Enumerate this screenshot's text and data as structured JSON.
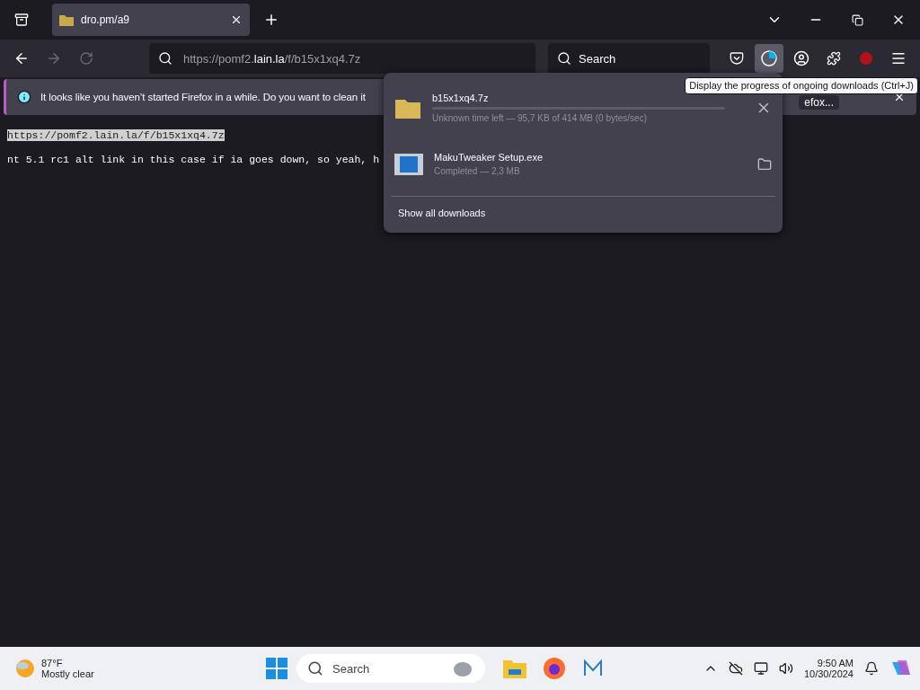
{
  "tabs": [
    {
      "title": "dro.pm/a9",
      "selected": true
    }
  ],
  "address_bar": {
    "value_prefix": "https://pomf2.",
    "value_domain": "lain.la",
    "value_suffix": "/f/b15x1xq4.7z"
  },
  "search": {
    "placeholder": "Search"
  },
  "downloads_button": {
    "active": true
  },
  "notification": {
    "message": "It looks like you haven’t started Firefox in a while. Do you want to clean it",
    "button": "efox..."
  },
  "page": {
    "lines": [
      {
        "text": "https://pomf2.lain.la/f/b15x1xq4.7z",
        "selected": true
      },
      {
        "text": "nt 5.1 rc1 alt link in this case if ia goes down, so yeah, h",
        "selected": false
      }
    ]
  },
  "downloads_panel": {
    "items": [
      {
        "kind": "in_progress",
        "name": "b15x1xq4.7z",
        "status": "Unknown time left — 95,7 KB of 414 MB (0 bytes/sec)",
        "level": 0.0
      },
      {
        "kind": "completed",
        "name": "MakuTweaker Setup.exe",
        "status": "Completed — 2,3 MB"
      }
    ],
    "footer": "Show all downloads"
  },
  "tooltip": "Display the progress of ongoing downloads (Ctrl+J)",
  "taskbar": {
    "weather": {
      "temp": "87°F",
      "condition": "Mostly clear"
    },
    "search_placeholder": "Search",
    "time": "9:50 AM",
    "date": "10/30/2024"
  }
}
